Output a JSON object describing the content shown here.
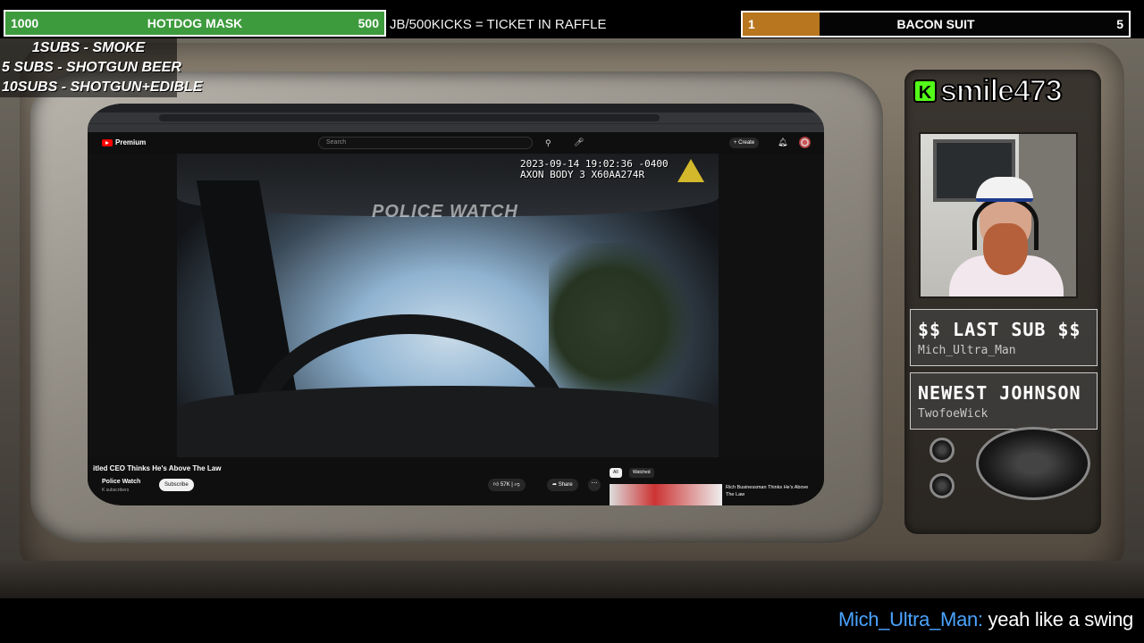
{
  "goals": {
    "left": {
      "start": "1000",
      "title": "HOTDOG MASK",
      "end": "500",
      "progress": 1.0,
      "fill_color": "#3d9b3d"
    },
    "right": {
      "start": "1",
      "title": "BACON SUIT",
      "end": "5",
      "progress": 0.2,
      "fill_color": "#b8761e"
    }
  },
  "ticker": "JB/500KICKS = TICKET IN RAFFLE",
  "sub_rules": [
    "1SUBS   - SMOKE",
    "5 SUBS  - SHOTGUN BEER",
    "10SUBS - SHOTGUN+EDIBLE"
  ],
  "browser": {
    "youtube": {
      "logo": "Premium",
      "search_placeholder": "Search",
      "create_label": "Create"
    },
    "video": {
      "timestamp": "2023-09-14 19:02:36 -0400\nAXON BODY 3 X60AA274R",
      "watermark": "POLICE WATCH"
    },
    "meta": {
      "title": "itled CEO Thinks He's Above The Law",
      "channel": "Police Watch",
      "subscribers": "K subscribers",
      "subscribe_label": "Subscribe",
      "likes": "57K",
      "share_label": "Share",
      "chip_all": "All",
      "chip_watched": "Watched",
      "rec_title": "Rich Businessman Thinks He's Above The Law"
    }
  },
  "streamer": {
    "name": "smile473",
    "brand_color": "#53fc18"
  },
  "last_sub": {
    "label": "$$ LAST SUB $$",
    "value": "Mich_Ultra_Man"
  },
  "newest": {
    "label": "NEWEST JOHNSON",
    "value": "TwofoeWick"
  },
  "chat": {
    "user": "Mich_Ultra_Man:",
    "message": " yeah like a swing",
    "user_color": "#4aa3ff"
  }
}
